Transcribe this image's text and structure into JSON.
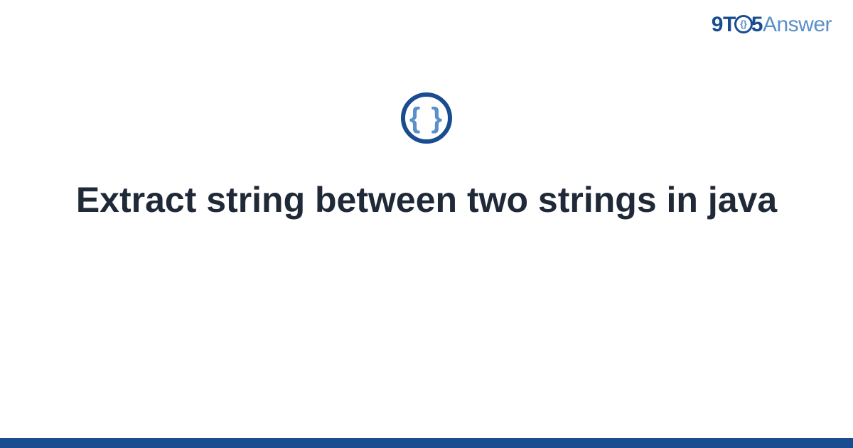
{
  "logo": {
    "part1": "9",
    "part2": "T",
    "part3": "5",
    "part4": "Answer"
  },
  "icon": {
    "name": "code-braces-icon",
    "glyph": "{ }"
  },
  "title": "Extract string between two strings in java",
  "colors": {
    "primary": "#1a4d8f",
    "secondary": "#5a8fc7",
    "text": "#1f2937"
  }
}
